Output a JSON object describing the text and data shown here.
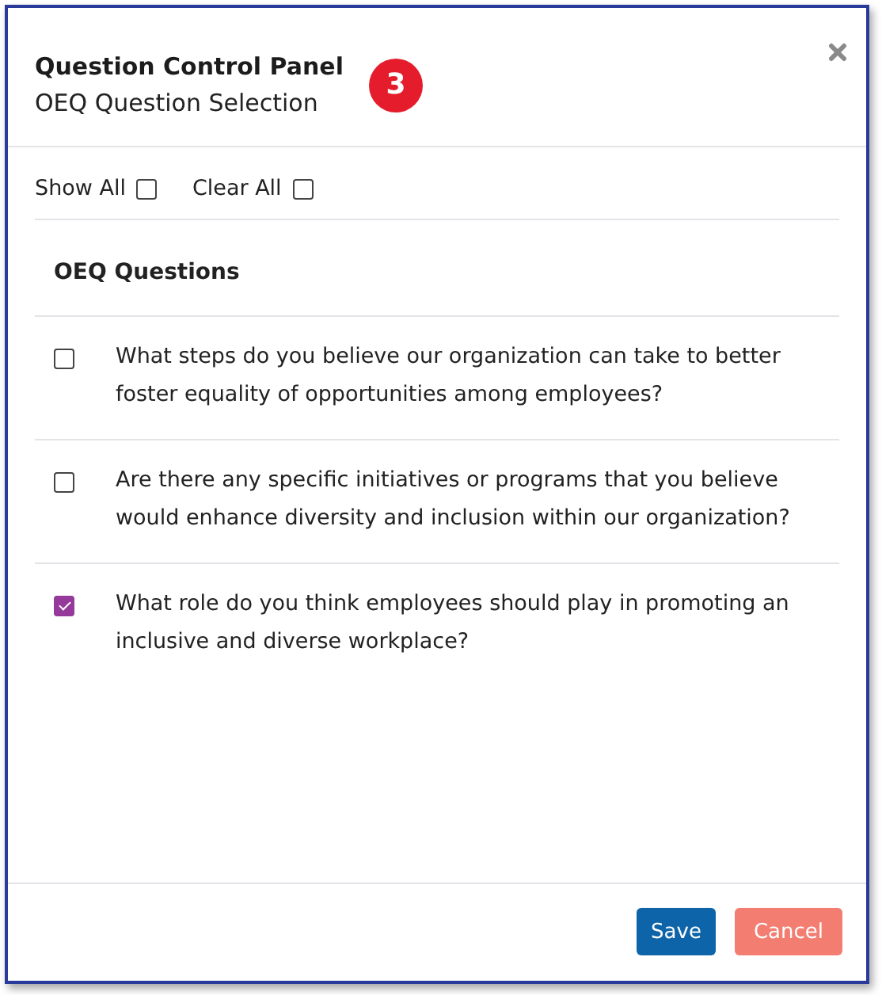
{
  "dialog": {
    "title": "Question Control Panel",
    "subtitle": "OEQ Question Selection",
    "badge": "3"
  },
  "toolbar": [
    {
      "label": "Show All",
      "checked": false
    },
    {
      "label": "Clear All",
      "checked": false
    }
  ],
  "section": {
    "heading": "OEQ Questions"
  },
  "questions": [
    {
      "text": "What steps do you believe our organization can take to better foster equality of opportunities among employees?",
      "checked": false
    },
    {
      "text": "Are there any specific initiatives or programs that you believe would enhance diversity and inclusion within our organization?",
      "checked": false
    },
    {
      "text": "What role do you think employees should play in promoting an inclusive and diverse workplace?",
      "checked": true
    }
  ],
  "buttons": [
    {
      "label": "Save",
      "kind": "primary"
    },
    {
      "label": "Cancel",
      "kind": "cancel"
    }
  ]
}
